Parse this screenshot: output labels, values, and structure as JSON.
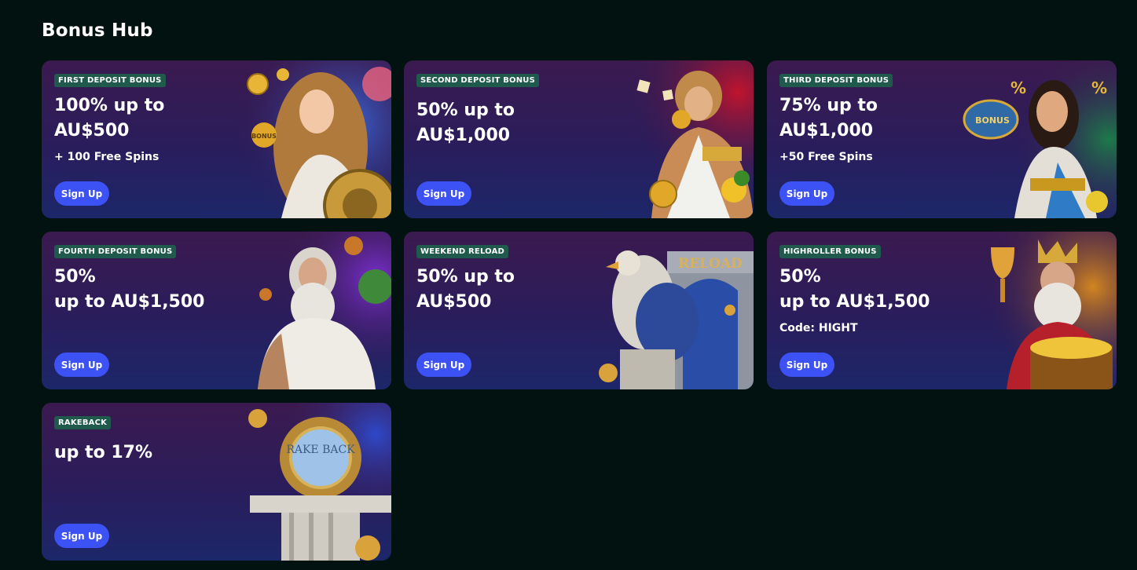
{
  "page": {
    "title": "Bonus Hub"
  },
  "cards": [
    {
      "badge": "FIRST DEPOSIT BONUS",
      "line1": "100% up to",
      "line2": "AU$500",
      "sub": "+ 100 Free Spins",
      "button": "Sign Up",
      "art_label": "BONUS",
      "accent": "#2a5bd8"
    },
    {
      "badge": "SECOND DEPOSIT BONUS",
      "line1": "50% up to",
      "line2": "AU$1,000",
      "sub": "",
      "button": "Sign Up",
      "art_label": "",
      "accent": "#b3142f"
    },
    {
      "badge": "THIRD DEPOSIT BONUS",
      "line1": "75% up to",
      "line2": "AU$1,000",
      "sub": "+50 Free Spins",
      "button": "Sign Up",
      "art_label": "BONUS",
      "accent": "#1d7a4a"
    },
    {
      "badge": "FOURTH DEPOSIT BONUS",
      "line1": "50%",
      "line2": "up to AU$1,500",
      "sub": "",
      "button": "Sign Up",
      "art_label": "",
      "accent": "#6b2fc4"
    },
    {
      "badge": "WEEKEND RELOAD",
      "line1": "50% up to",
      "line2": "AU$500",
      "sub": "",
      "button": "Sign Up",
      "art_label": "RELOAD",
      "accent": "#2b4da8"
    },
    {
      "badge": "HIGHROLLER BONUS",
      "line1": "50%",
      "line2": "up to AU$1,500",
      "sub": "Code: HIGHT",
      "button": "Sign Up",
      "art_label": "",
      "accent": "#c9781c"
    },
    {
      "badge": "RAKEBACK",
      "line1": "up to 17%",
      "line2": "",
      "sub": "",
      "button": "Sign Up",
      "art_label": "RAKE BACK",
      "accent": "#2f3fb0"
    }
  ]
}
